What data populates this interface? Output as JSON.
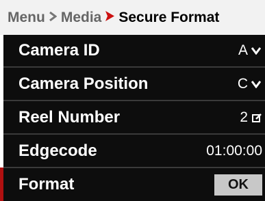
{
  "breadcrumb": {
    "items": [
      "Menu",
      "Media",
      "Secure Format"
    ]
  },
  "menu": {
    "rows": [
      {
        "label": "Camera ID",
        "value": "A",
        "icon": "chevron-down-icon"
      },
      {
        "label": "Camera Position",
        "value": "C",
        "icon": "chevron-down-icon"
      },
      {
        "label": "Reel Number",
        "value": "2",
        "icon": "edit-icon"
      },
      {
        "label": "Edgecode",
        "value": "01:00:00"
      },
      {
        "label": "Format",
        "button": "OK"
      }
    ]
  },
  "colors": {
    "breadcrumb_bg": "#f2f2f2",
    "menu_bg": "#0d0d0d",
    "accent_red": "#b01010",
    "button_bg": "#c8c8c8"
  }
}
